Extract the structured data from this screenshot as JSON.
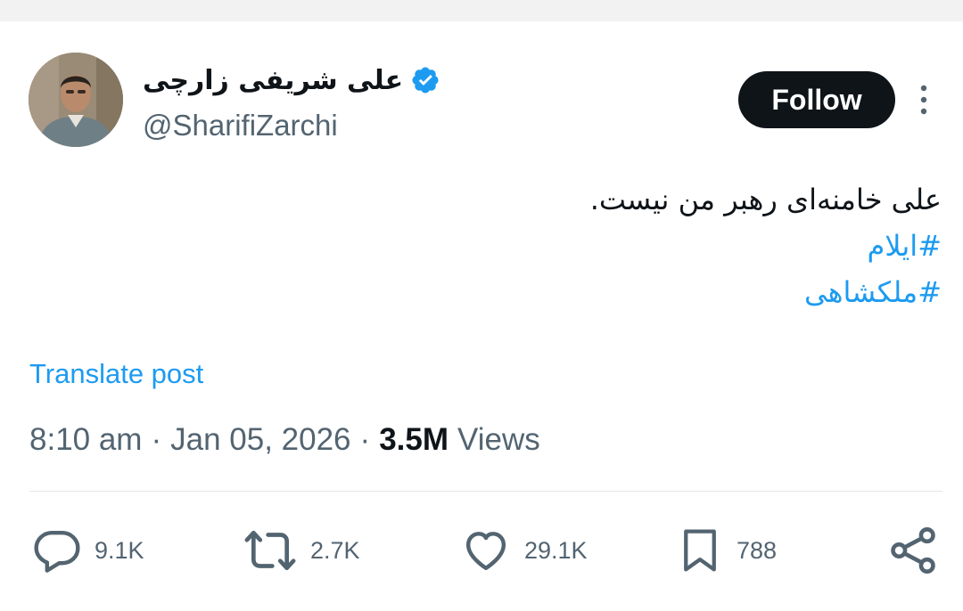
{
  "author": {
    "display_name": "علی شریفی زارچی",
    "handle": "@SharifiZarchi",
    "verified": true,
    "avatar_icon": "profile-photo"
  },
  "follow_label": "Follow",
  "tweet": {
    "text": "علی خامنه‌ای رهبر من نیست.",
    "hashtags": [
      "#ایلام",
      "#ملکشاهی"
    ],
    "translate_label": "Translate post"
  },
  "meta": {
    "time": "8:10 am",
    "separator": "·",
    "date": "Jan 05, 2026",
    "views_count": "3.5M",
    "views_label": "Views"
  },
  "actions": {
    "replies": "9.1K",
    "reposts": "2.7K",
    "likes": "29.1K",
    "bookmarks": "788"
  },
  "colors": {
    "accent": "#1d9bf0",
    "text_primary": "#0f1419",
    "text_secondary": "#536471",
    "follow_bg": "#0f1419"
  }
}
